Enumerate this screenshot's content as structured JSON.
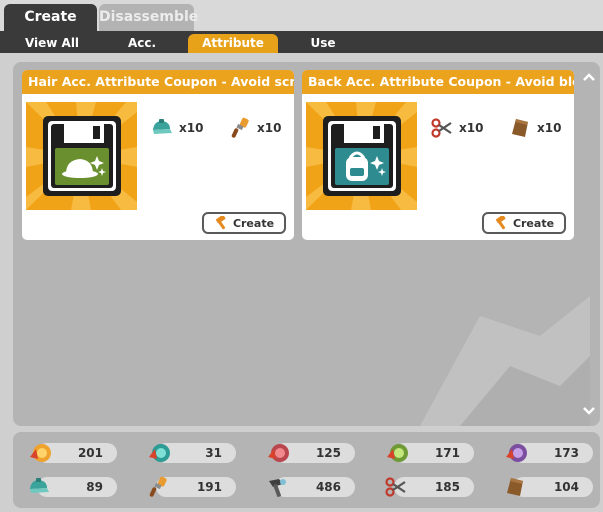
{
  "top_tabs": [
    {
      "label": "Create",
      "active": true
    },
    {
      "label": "Disassemble",
      "active": false
    }
  ],
  "sub_tabs": [
    {
      "label": "View All",
      "active": false
    },
    {
      "label": "Acc.",
      "active": false
    },
    {
      "label": "Attribute",
      "active": true
    },
    {
      "label": "Use",
      "active": false
    }
  ],
  "recipes": [
    {
      "title": "Hair Acc. Attribute Coupon - Avoid screen",
      "icon": "floppy-hat-icon",
      "icon_color": "#6a8f2e",
      "materials": [
        {
          "icon": "teal-cap-icon",
          "qty": "x10"
        },
        {
          "icon": "brush-icon",
          "qty": "x10"
        }
      ],
      "button_label": "Create"
    },
    {
      "title": "Back Acc. Attribute Coupon - Avoid block",
      "icon": "floppy-backpack-icon",
      "icon_color": "#2e8b8f",
      "materials": [
        {
          "icon": "scissors-icon",
          "qty": "x10"
        },
        {
          "icon": "leather-icon",
          "qty": "x10"
        }
      ],
      "button_label": "Create"
    }
  ],
  "inventory": [
    {
      "icon": "orange-crystal-icon",
      "qty": "201"
    },
    {
      "icon": "teal-crystal-icon",
      "qty": "31"
    },
    {
      "icon": "red-crystal-icon",
      "qty": "125"
    },
    {
      "icon": "green-crystal-icon",
      "qty": "171"
    },
    {
      "icon": "purple-crystal-icon",
      "qty": "173"
    },
    {
      "icon": "teal-cap-icon",
      "qty": "89"
    },
    {
      "icon": "brush-icon",
      "qty": "191"
    },
    {
      "icon": "tool-icon",
      "qty": "486"
    },
    {
      "icon": "scissors-icon",
      "qty": "185"
    },
    {
      "icon": "leather-icon",
      "qty": "104"
    }
  ],
  "colors": {
    "accent": "#eba21c",
    "tab_bar": "#3a3a3a",
    "panel": "#b4b4b4"
  }
}
